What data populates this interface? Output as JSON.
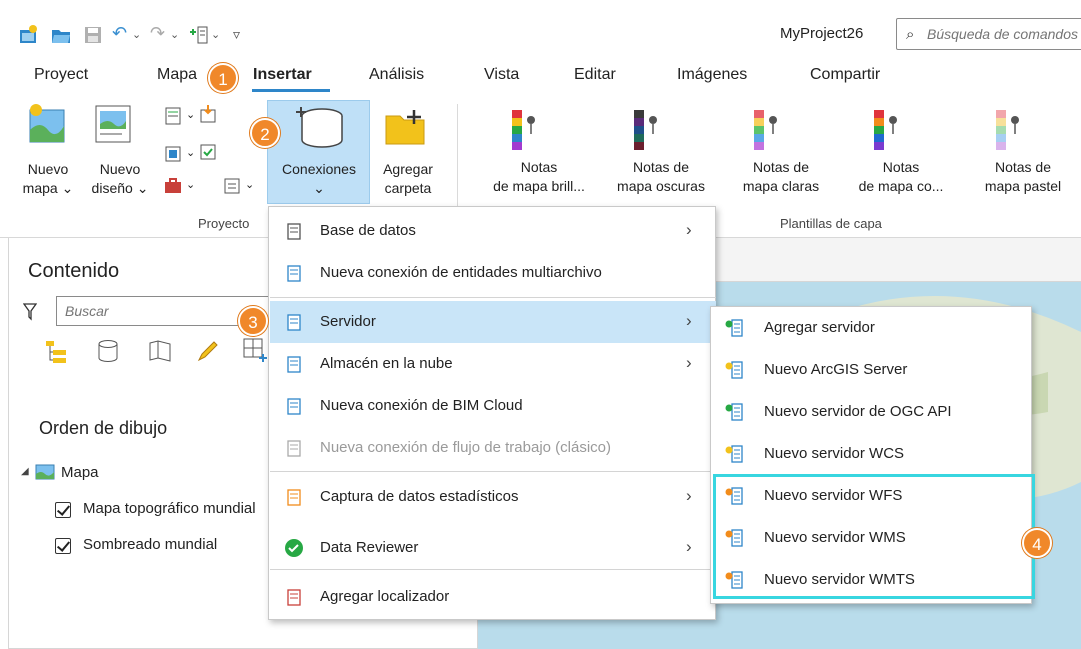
{
  "title_bar": {
    "project_name": "MyProject26",
    "search_placeholder": "Búsqueda de comandos"
  },
  "tabs": [
    {
      "label": "Proyect"
    },
    {
      "label": "Mapa"
    },
    {
      "label": "Insertar",
      "active": true
    },
    {
      "label": "Análisis"
    },
    {
      "label": "Vista"
    },
    {
      "label": "Editar"
    },
    {
      "label": "Imágenes"
    },
    {
      "label": "Compartir"
    }
  ],
  "ribbon": {
    "nuevo_mapa": {
      "line1": "Nuevo",
      "line2": "mapa"
    },
    "nuevo_diseno": {
      "line1": "Nuevo",
      "line2": "diseño"
    },
    "conexiones": {
      "line1": "Conexiones"
    },
    "agregar_carpeta": {
      "line1": "Agregar",
      "line2": "carpeta"
    },
    "group_proyecto": "Proyecto",
    "group_plantillas": "Plantillas de capa",
    "layer_templates": [
      {
        "line1": "Notas",
        "line2": "de mapa brill...",
        "colors": [
          "#e0343c",
          "#f2c21b",
          "#27a844",
          "#2e86c9",
          "#a23bd0"
        ]
      },
      {
        "line1": "Notas de",
        "line2": "mapa oscuras",
        "colors": [
          "#3a3a3a",
          "#5a2b7a",
          "#1f4f8a",
          "#1f6b5a",
          "#6b1f2e"
        ]
      },
      {
        "line1": "Notas de",
        "line2": "mapa claras",
        "colors": [
          "#e8616a",
          "#f7d05a",
          "#5cc46a",
          "#5aa9e6",
          "#c273e0"
        ]
      },
      {
        "line1": "Notas",
        "line2": "de mapa co...",
        "colors": [
          "#e0343c",
          "#f28c1b",
          "#27a844",
          "#1f6bd0",
          "#7a3bd0"
        ]
      },
      {
        "line1": "Notas de",
        "line2": "mapa pastel",
        "colors": [
          "#f2a6ab",
          "#f7e09a",
          "#a6dcb0",
          "#a6cff2",
          "#d9b3ec"
        ]
      }
    ]
  },
  "badges": [
    "1",
    "2",
    "3",
    "4"
  ],
  "contents": {
    "title": "Contenido",
    "search_placeholder": "Buscar",
    "draw_order": "Orden de dibujo",
    "map_layer": "Mapa",
    "layers": [
      "Mapa topográfico mundial",
      "Sombreado mundial"
    ]
  },
  "menu": {
    "items": [
      {
        "label": "Base de datos",
        "submenu": true
      },
      {
        "label": "Nueva conexión de entidades multiarchivo",
        "submenu": false
      },
      {
        "label": "Servidor",
        "submenu": true,
        "highlighted": true
      },
      {
        "label": "Almacén en la nube",
        "submenu": true
      },
      {
        "label": "Nueva conexión de BIM Cloud",
        "submenu": false
      },
      {
        "label": "Nueva conexión de flujo de trabajo (clásico)",
        "submenu": false,
        "disabled": true
      },
      {
        "label": "Captura de datos estadísticos",
        "submenu": true
      },
      {
        "label": "Data Reviewer",
        "submenu": true
      },
      {
        "label": "Agregar localizador",
        "submenu": false
      }
    ]
  },
  "submenu": {
    "items": [
      {
        "label": "Agregar servidor"
      },
      {
        "label": "Nuevo ArcGIS Server"
      },
      {
        "label": "Nuevo servidor de OGC API"
      },
      {
        "label": "Nuevo servidor WCS"
      },
      {
        "label": "Nuevo servidor WFS"
      },
      {
        "label": "Nuevo servidor WMS"
      },
      {
        "label": "Nuevo servidor WMTS"
      }
    ]
  },
  "colors": {
    "accent": "#2e86c9",
    "badge": "#f0882a",
    "highlight_box": "#38d6e0",
    "menu_highlight": "#c9e5f8"
  }
}
